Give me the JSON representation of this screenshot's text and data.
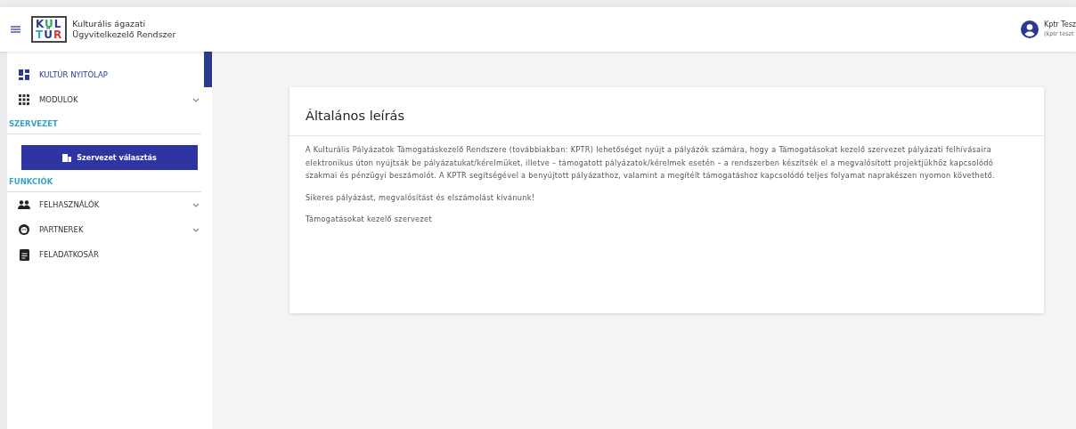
{
  "header": {
    "logo_lines": [
      "KUL",
      "TÜR"
    ],
    "app_title": [
      "Kulturális ágazati",
      "Ügyvitelkezelő Rendszer"
    ],
    "user": {
      "name": "Kptr Tesz",
      "login": "(kptr teszt"
    }
  },
  "sidebar": {
    "items": [
      {
        "label": "KULTÚR NYITÓLAP",
        "kind": "dashboard",
        "selected": true,
        "expandable": false
      },
      {
        "label": "MODULOK",
        "kind": "grid",
        "selected": false,
        "expandable": true
      }
    ],
    "sections": [
      {
        "title": "SZERVEZET",
        "button": "Szervezet választás"
      },
      {
        "title": "FUNKCIÓK",
        "items": [
          {
            "label": "FELHASZNÁLÓK",
            "kind": "people",
            "selected": false,
            "expandable": true
          },
          {
            "label": "PARTNEREK",
            "kind": "face",
            "selected": false,
            "expandable": true
          },
          {
            "label": "FELADATKOSÁR",
            "kind": "clipboard",
            "selected": false,
            "expandable": false
          }
        ]
      }
    ]
  },
  "card": {
    "title": "Általános leírás",
    "paragraphs": [
      "A Kulturális Pályázatok Támogatáskezelő Rendszere (továbbiakban: KPTR) lehetőséget nyújt a pályázók számára, hogy a Támogatásokat kezelő szervezet pályázati felhívásaira elektronikus úton nyújtsák be pályázatukat/kérelmüket, illetve – támogatott pályázatok/kérelmek esetén – a rendszerben készítsék el a megvalósított projektjükhöz kapcsolódó szakmai és pénzügyi beszámolót. A KPTR segítségével a benyújtott pályázathoz, valamint a megítélt támogatáshoz kapcsolódó teljes folyamat naprakészen nyomon követhető.",
      "Sikeres pályázást, megvalósítást és elszámolást kívánunk!",
      "Támogatásokat kezelő szervezet"
    ]
  }
}
